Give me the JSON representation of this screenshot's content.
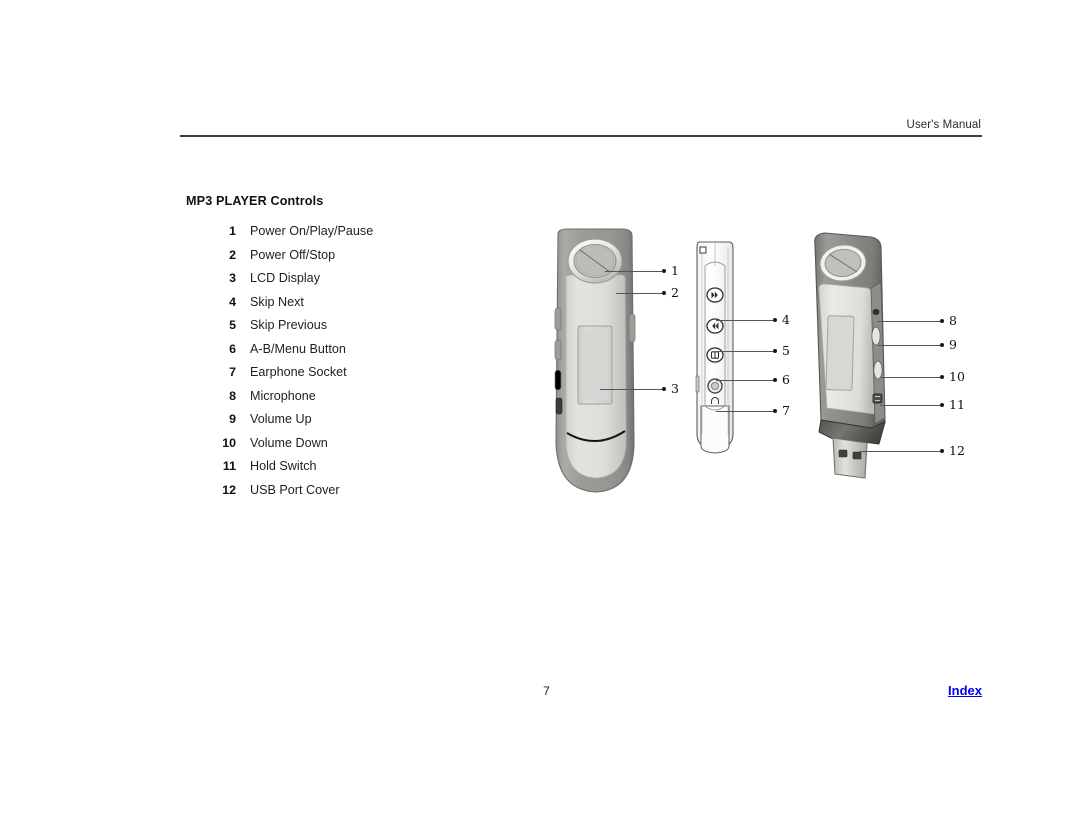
{
  "header": {
    "title": "User's Manual"
  },
  "section": {
    "title": "MP3 PLAYER Controls"
  },
  "controls": [
    {
      "number": "1",
      "label": "Power On/Play/Pause"
    },
    {
      "number": "2",
      "label": "Power Off/Stop"
    },
    {
      "number": "3",
      "label": "LCD Display"
    },
    {
      "number": "4",
      "label": "Skip Next"
    },
    {
      "number": "5",
      "label": "Skip Previous"
    },
    {
      "number": "6",
      "label": "A-B/Menu Button"
    },
    {
      "number": "7",
      "label": "Earphone Socket"
    },
    {
      "number": "8",
      "label": "Microphone"
    },
    {
      "number": "9",
      "label": "Volume Up"
    },
    {
      "number": "10",
      "label": "Volume Down"
    },
    {
      "number": "11",
      "label": "Hold Switch"
    },
    {
      "number": "12",
      "label": "USB Port Cover"
    }
  ],
  "figure": {
    "views": [
      {
        "name": "front-view",
        "description": "MP3 player front view"
      },
      {
        "name": "side-view",
        "description": "MP3 player side view with buttons"
      },
      {
        "name": "perspective-view",
        "description": "MP3 player perspective view with USB connector"
      }
    ],
    "callouts": [
      {
        "number": "1"
      },
      {
        "number": "2"
      },
      {
        "number": "3"
      },
      {
        "number": "4"
      },
      {
        "number": "5"
      },
      {
        "number": "6"
      },
      {
        "number": "7"
      },
      {
        "number": "8"
      },
      {
        "number": "9"
      },
      {
        "number": "10"
      },
      {
        "number": "11"
      },
      {
        "number": "12"
      }
    ]
  },
  "footer": {
    "page_number": "7",
    "index_link": "Index"
  },
  "colors": {
    "link": "#0000ee",
    "rule": "#3d3d3d",
    "body_light": "#d9dbd7",
    "body_dark": "#8d8e8b",
    "text": "#1a1a1a"
  }
}
